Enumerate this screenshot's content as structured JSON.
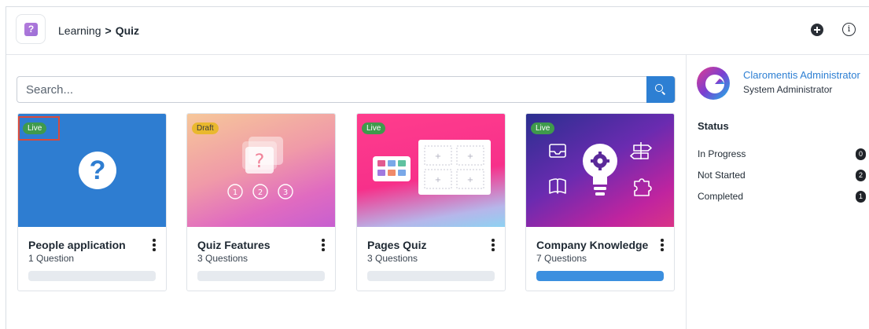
{
  "breadcrumb": {
    "parent": "Learning",
    "separator": ">",
    "current": "Quiz"
  },
  "search": {
    "placeholder": "Search..."
  },
  "cards": [
    {
      "title": "People application",
      "subtitle": "1 Question",
      "status": "Live",
      "progress": 0,
      "image_icon": "question-mark-icon"
    },
    {
      "title": "Quiz Features",
      "subtitle": "3 Questions",
      "status": "Draft",
      "progress": 0,
      "image_icon": "quiz-steps-icon"
    },
    {
      "title": "Pages Quiz",
      "subtitle": "3 Questions",
      "status": "Live",
      "progress": 0,
      "image_icon": "page-grid-icon"
    },
    {
      "title": "Company Knowledge",
      "subtitle": "7 Questions",
      "status": "Live",
      "progress": 100,
      "image_icon": "lightbulb-gear-icon"
    }
  ],
  "user": {
    "name": "Claromentis Administrator",
    "role": "System Administrator"
  },
  "status": {
    "title": "Status",
    "rows": [
      {
        "label": "In Progress",
        "count": "0"
      },
      {
        "label": "Not Started",
        "count": "2"
      },
      {
        "label": "Completed",
        "count": "1"
      }
    ]
  },
  "colors": {
    "accent": "#2d7fd3",
    "live": "#3f9a4c",
    "draft": "#e9b82e",
    "highlight": "#d94a3c"
  }
}
